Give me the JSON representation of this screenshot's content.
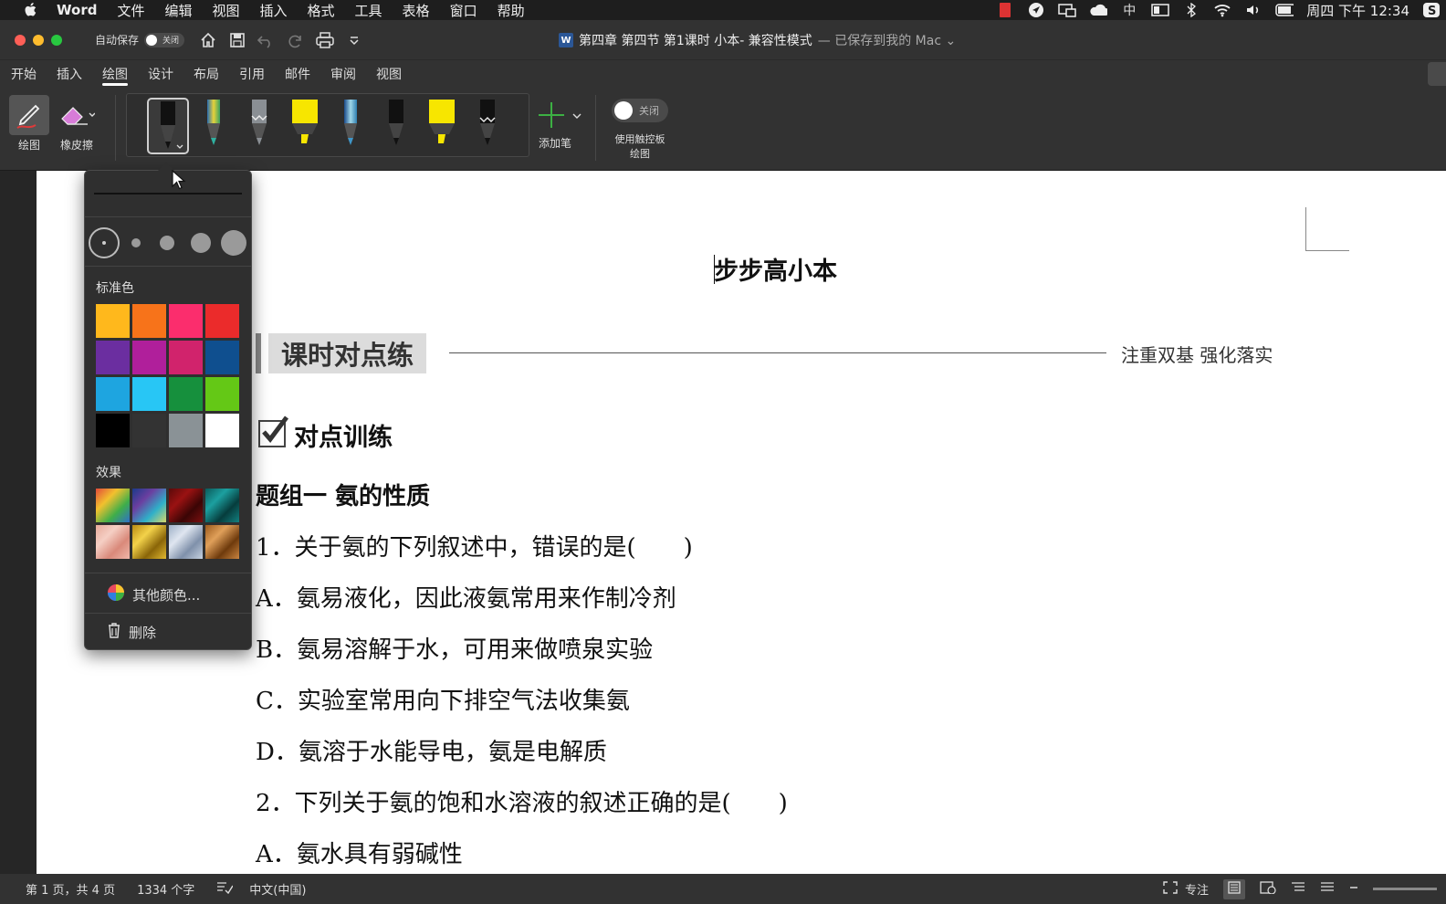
{
  "menubar": {
    "app": "Word",
    "items": [
      "文件",
      "编辑",
      "视图",
      "插入",
      "格式",
      "工具",
      "表格",
      "窗口",
      "帮助"
    ],
    "ime": "中",
    "clock": "周四 下午 12:34"
  },
  "titlebar": {
    "autosave_label": "自动保存",
    "autosave_state": "关闭",
    "doc_name": "第四章 第四节 第1课时 小本",
    "doc_mode": " -  兼容性模式",
    "saved_status": "— 已保存到我的 Mac ⌄",
    "word_badge": "W"
  },
  "ribbon_tabs": [
    "开始",
    "插入",
    "绘图",
    "设计",
    "布局",
    "引用",
    "邮件",
    "审阅",
    "视图"
  ],
  "ribbon": {
    "draw_label": "绘图",
    "eraser_label": "橡皮擦",
    "add_pen_label": "添加笔",
    "trackpad_toggle": "关闭",
    "trackpad_label_1": "使用触控板",
    "trackpad_label_2": "绘图"
  },
  "pens": [
    {
      "name": "pen-black",
      "color": "#111111",
      "selected": true
    },
    {
      "name": "pen-galaxy",
      "color": "#5aa86e"
    },
    {
      "name": "pen-gray",
      "color": "#8a8f94"
    },
    {
      "name": "highlighter-yellow",
      "color": "#f7e600"
    },
    {
      "name": "pen-ocean",
      "color": "#3f95c8"
    },
    {
      "name": "pen-black-2",
      "color": "#111111"
    },
    {
      "name": "highlighter-yellow-2",
      "color": "#f7e600"
    },
    {
      "name": "pen-black-3",
      "color": "#111111"
    }
  ],
  "popup": {
    "standard_colors_label": "标准色",
    "standard_colors": [
      "#ffb81c",
      "#f7731a",
      "#fb2d6d",
      "#eb2b2b",
      "#6b2ea0",
      "#b01f9b",
      "#d1236c",
      "#0f4f8f",
      "#1ea5e0",
      "#28c6f5",
      "#16903d",
      "#64c816",
      "#000000",
      "#333333",
      "#8a9296",
      "#ffffff"
    ],
    "effects_label": "效果",
    "effects": [
      {
        "name": "rainbow",
        "colors": [
          "#e24a3a",
          "#f2c12e",
          "#3fae49",
          "#2f6fc9"
        ]
      },
      {
        "name": "galaxy",
        "colors": [
          "#1b3a8a",
          "#6b3fa0",
          "#2fb0c9",
          "#d8d86a"
        ]
      },
      {
        "name": "lava",
        "colors": [
          "#5a0a0a",
          "#9a1212",
          "#3a0505",
          "#7a1010"
        ]
      },
      {
        "name": "ocean",
        "colors": [
          "#0b5a5a",
          "#1ca0a0",
          "#063c3c",
          "#138080"
        ]
      },
      {
        "name": "rose-gold",
        "colors": [
          "#e6a99a",
          "#f5cfc4",
          "#d9897a",
          "#f0b8aa"
        ]
      },
      {
        "name": "gold",
        "colors": [
          "#b88a12",
          "#f3d24a",
          "#8a6508",
          "#e0b830"
        ]
      },
      {
        "name": "silver",
        "colors": [
          "#9eb0c8",
          "#dfe6f0",
          "#7f90aa",
          "#c5d1e0"
        ]
      },
      {
        "name": "bronze",
        "colors": [
          "#9c5a1c",
          "#e0a05a",
          "#6e3a0c",
          "#c98440"
        ]
      }
    ],
    "more_colors": "其他颜色...",
    "delete": "删除"
  },
  "document": {
    "heading": "步步高小本",
    "section": "课时对点练",
    "section_sub": "注重双基  强化落实",
    "training": "对点训练",
    "group": "题组一    氨的性质",
    "lines": [
      "1．关于氨的下列叙述中，错误的是(　　)",
      "A．氨易液化，因此液氨常用来作制冷剂",
      "B．氨易溶解于水，可用来做喷泉实验",
      "C．实验室常用向下排空气法收集氨",
      "D．氨溶于水能导电，氨是电解质",
      "2．下列关于氨的饱和水溶液的叙述正确的是(　　)",
      "A．氨水具有弱碱性"
    ]
  },
  "statusbar": {
    "page": "第 1 页，共 4 页",
    "words": "1334 个字",
    "language": "中文(中国)",
    "focus": "专注"
  }
}
